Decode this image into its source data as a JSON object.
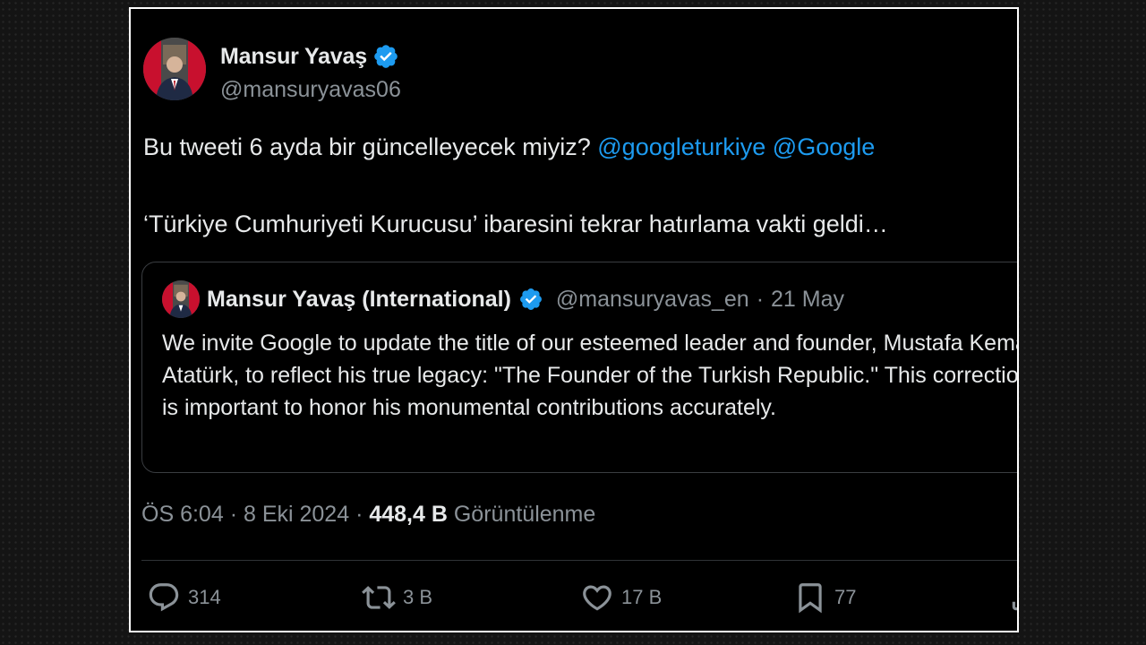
{
  "tweet": {
    "author": {
      "name": "Mansur Yavaş",
      "handle": "@mansuryavas06",
      "verified_icon": "verified-badge-icon"
    },
    "text_line1_prefix": "Bu tweeti 6 ayda bir güncelleyecek miyiz? ",
    "mention1": "@googleturkiye",
    "mention2": "@Google",
    "text_line2": "‘Türkiye Cumhuriyeti Kurucusu’ ibaresini tekrar hatırlama vakti geldi…",
    "quoted": {
      "name": "Mansur Yavaş (International)",
      "handle": "@mansuryavas_en",
      "separator": "·",
      "date": "21 May",
      "text": "We invite Google to update the title of our esteemed leader and founder, Mustafa Kemal Atatürk, to reflect his true legacy: \"The Founder of the Turkish Republic.\" This correction is important to honor his monumental contributions accurately."
    },
    "meta": {
      "time": "ÖS 6:04",
      "separator": "·",
      "date": "8 Eki 2024",
      "views_count": "448,4 B",
      "views_label": "Görüntülenme"
    },
    "actions": {
      "replies": "314",
      "retweets": "3 B",
      "likes": "17 B",
      "bookmarks": "77"
    }
  },
  "colors": {
    "background": "#000000",
    "link": "#1d9bf0",
    "secondary_text": "#8b9298",
    "verified": "#1d9bf0"
  }
}
